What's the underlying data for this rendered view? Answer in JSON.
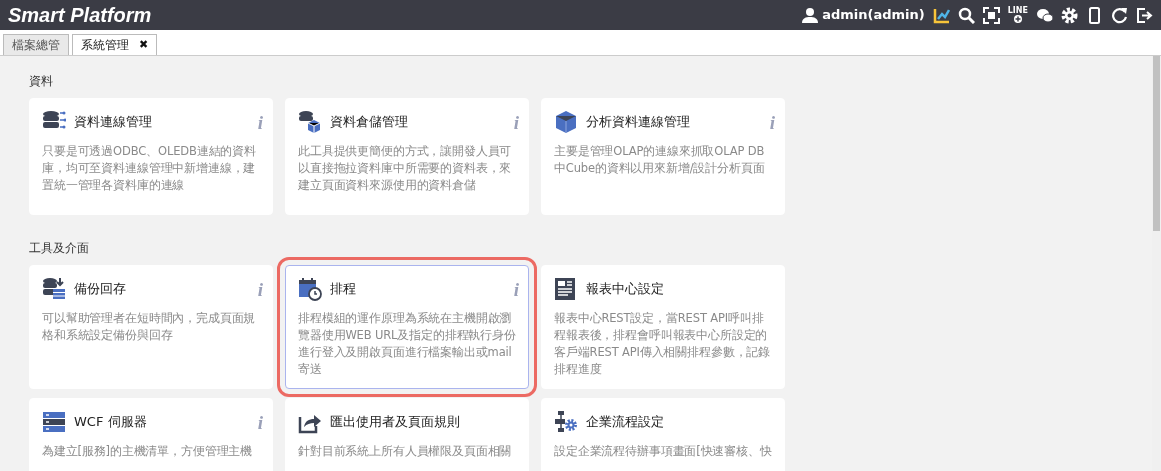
{
  "header": {
    "title": "Smart Platform",
    "user": "admin(admin)",
    "line_label": "LINE",
    "tools": [
      {
        "kind": "chart"
      },
      {
        "kind": "search"
      },
      {
        "kind": "fullscreen"
      },
      {
        "kind": "line"
      },
      {
        "kind": "wechat"
      },
      {
        "kind": "settings"
      },
      {
        "kind": "mobile"
      },
      {
        "kind": "refresh"
      },
      {
        "kind": "logout"
      }
    ]
  },
  "tabs": [
    {
      "label": "檔案總管",
      "selected": false
    },
    {
      "label": "系統管理",
      "selected": true,
      "close_label": "✖"
    }
  ],
  "sections": [
    {
      "title": "資料",
      "cards": [
        {
          "title": "資料連線管理",
          "desc": "只要是可透過ODBC、OLEDB連結的資料庫，均可至資料連線管理中新增連線，建置統一管理各資料庫的連線",
          "info": "i",
          "selected": false
        },
        {
          "title": "資料倉儲管理",
          "desc": "此工具提供更簡便的方式，讓開發人員可以直接拖拉資料庫中所需要的資料表，來建立頁面資料來源使用的資料倉儲",
          "info": "i",
          "selected": false
        },
        {
          "title": "分析資料連線管理",
          "desc": "主要是管理OLAP的連線來抓取OLAP DB中Cube的資料以用來新增/設計分析頁面",
          "info": "i",
          "selected": false
        }
      ]
    },
    {
      "title": "工具及介面",
      "cards": [
        {
          "title": "備份回存",
          "desc": "可以幫助管理者在短時間內，完成頁面規格和系統設定備份與回存",
          "info": "i",
          "selected": false
        },
        {
          "title": "排程",
          "desc": "排程模組的運作原理為系統在主機開啟瀏覽器使用WEB URL及指定的排程執行身份進行登入及開啟頁面進行檔案輸出或mail寄送",
          "info": "i",
          "selected": true
        },
        {
          "title": "報表中心設定",
          "desc": "報表中心REST設定，當REST API呼叫排程報表後，排程會呼叫報表中心所設定的客戶端REST API傳入相關排程參數，記錄排程進度",
          "selected": false
        },
        {
          "title": "WCF 伺服器",
          "desc": "為建立[服務]的主機清單，方便管理主機",
          "info": "i",
          "selected": false
        },
        {
          "title": "匯出使用者及頁面規則",
          "desc": "針對目前系統上所有人員權限及頁面相關",
          "selected": false
        },
        {
          "title": "企業流程設定",
          "desc": "設定企業流程待辦事項畫面[快速審核、快",
          "selected": false
        }
      ]
    }
  ]
}
